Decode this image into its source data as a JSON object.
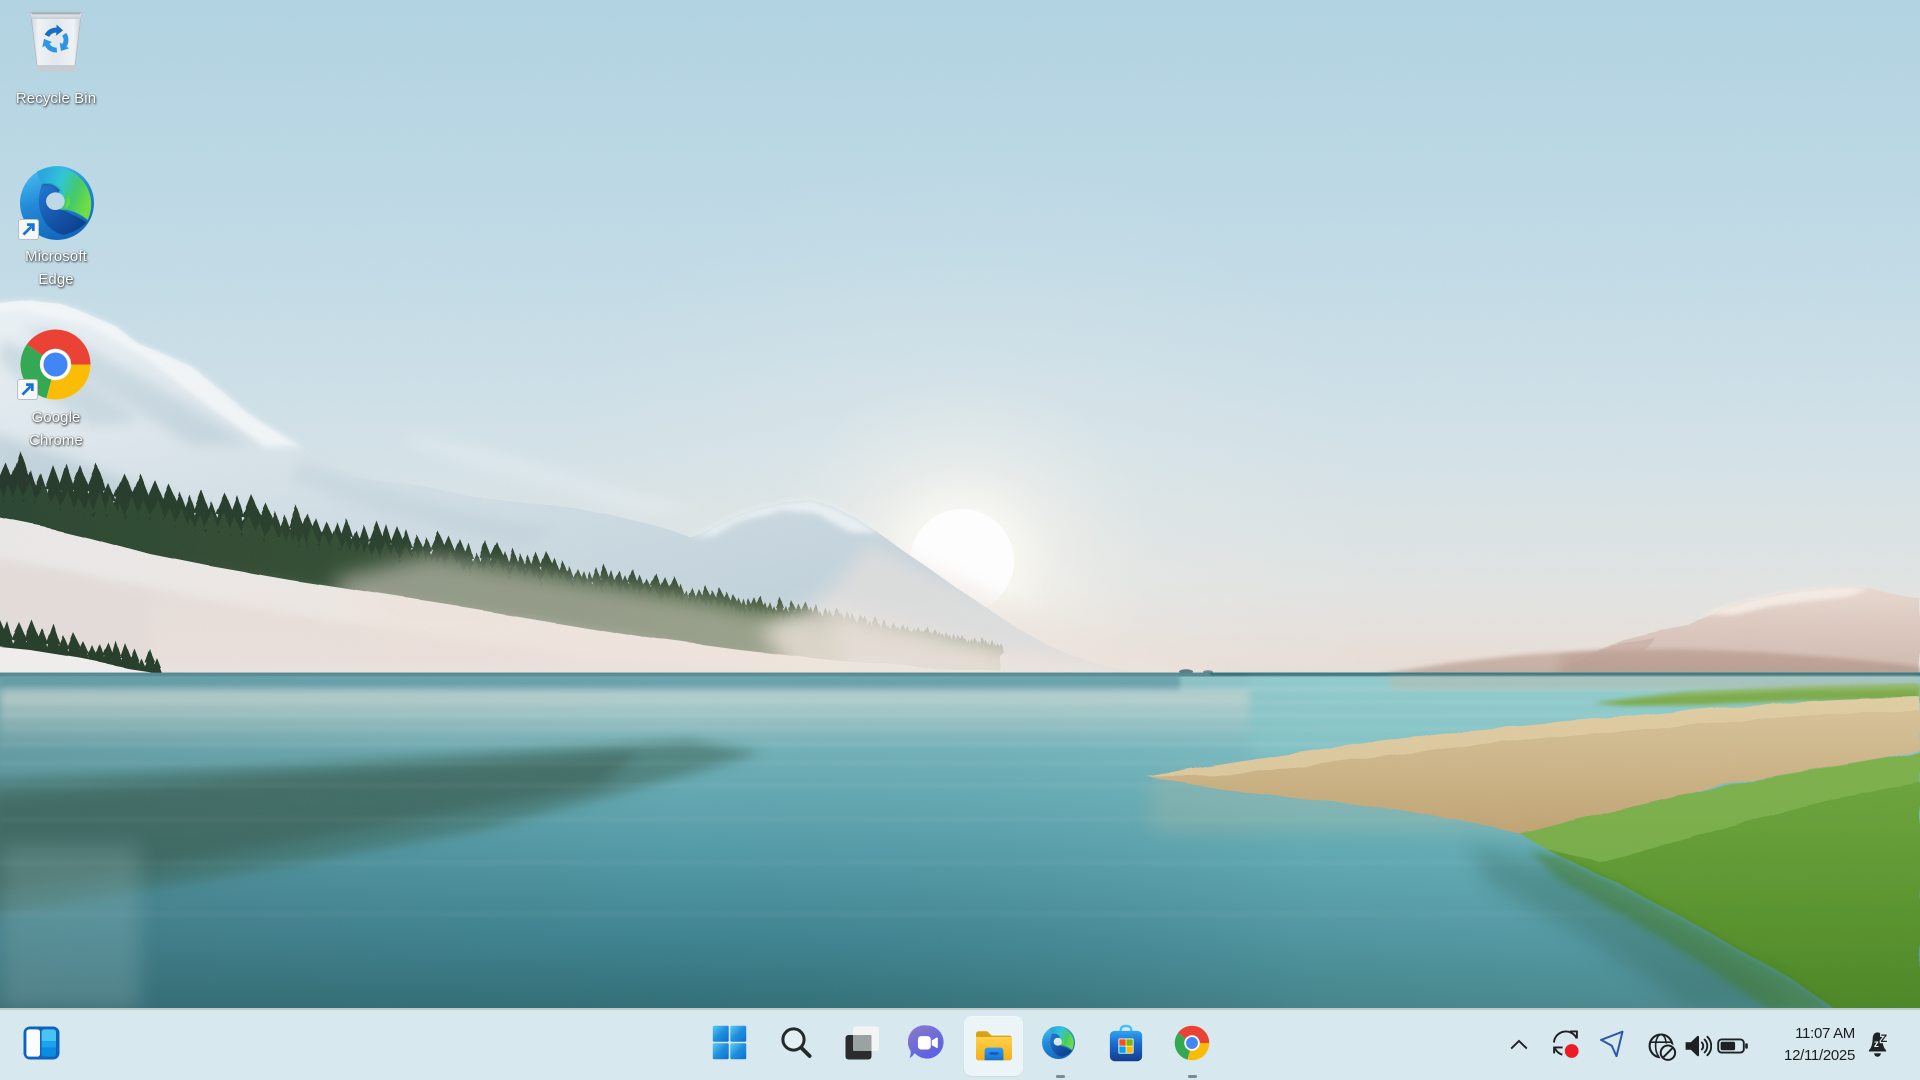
{
  "desktop": {
    "icons": [
      {
        "id": "recycle-bin",
        "label": "Recycle Bin",
        "lines": [
          "Recycle Bin"
        ]
      },
      {
        "id": "microsoft-edge",
        "label": "Microsoft Edge",
        "lines": [
          "Microsoft",
          "Edge"
        ]
      },
      {
        "id": "google-chrome",
        "label": "Google Chrome",
        "lines": [
          "Google",
          "Chrome"
        ]
      }
    ]
  },
  "taskbar": {
    "buttons": [
      {
        "id": "widgets",
        "name": "Widgets"
      },
      {
        "id": "start",
        "name": "Start"
      },
      {
        "id": "search",
        "name": "Search"
      },
      {
        "id": "task-view",
        "name": "Task View"
      },
      {
        "id": "chat",
        "name": "Chat"
      },
      {
        "id": "file-explorer",
        "name": "File Explorer",
        "state": "highlighted"
      },
      {
        "id": "edge",
        "name": "Microsoft Edge",
        "state": "running"
      },
      {
        "id": "store",
        "name": "Microsoft Store"
      },
      {
        "id": "chrome",
        "name": "Google Chrome",
        "state": "running"
      }
    ],
    "colors": {
      "background": "#d7e9ef",
      "highlight": "#ebf5f8",
      "running_indicator": "#7d8a8e"
    }
  },
  "systray": {
    "icons": [
      {
        "id": "chevron-up",
        "name": "Show hidden icons"
      },
      {
        "id": "sync-recording",
        "name": "Sync status"
      },
      {
        "id": "location",
        "name": "Location in use"
      },
      {
        "id": "network-offline",
        "name": "No internet access"
      },
      {
        "id": "volume",
        "name": "Speakers"
      },
      {
        "id": "battery",
        "name": "Battery"
      }
    ],
    "clock": {
      "time": "11:07 AM",
      "date": "12/11/2025"
    },
    "notification": {
      "id": "bell-dnd",
      "name": "Do not disturb"
    }
  }
}
